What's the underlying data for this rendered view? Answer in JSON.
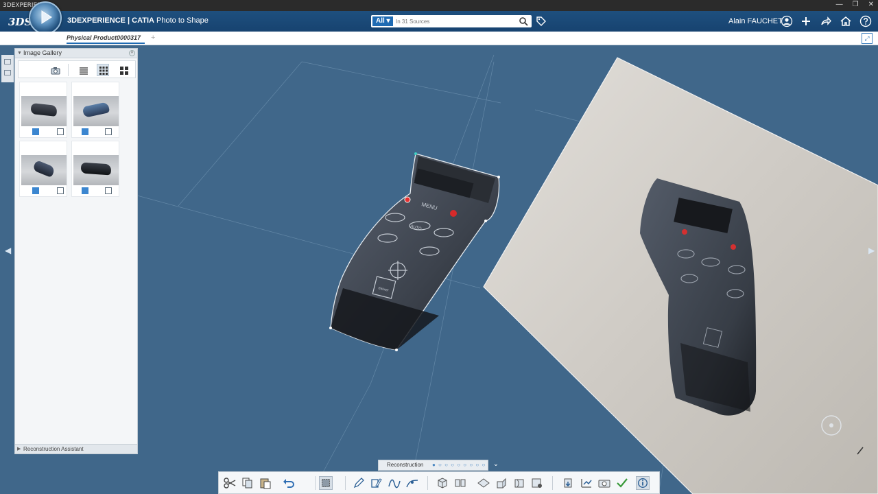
{
  "os": {
    "title": "3DEXPERIENCE"
  },
  "header": {
    "brand": "3DEXPERIENCE | CATIA",
    "app": "Photo to Shape",
    "search": {
      "scope": "All",
      "placeholder": "In 31 Sources"
    },
    "user": "Alain FAUCHET",
    "icons": [
      "user-icon",
      "plus-icon",
      "share-icon",
      "home-icon",
      "help-icon"
    ]
  },
  "tab": {
    "label": "Physical Product0000317",
    "add": "+"
  },
  "gallery": {
    "title": "Image Gallery",
    "footer": "Reconstruction Assistant",
    "thumbnails": [
      {
        "name": "photo-1"
      },
      {
        "name": "photo-2"
      },
      {
        "name": "photo-3"
      },
      {
        "name": "photo-4"
      }
    ]
  },
  "remote": {
    "menu_label": "MENU",
    "auto_label": "AUTO",
    "brand_label": "Steinel"
  },
  "actionbar": {
    "section": "Reconstruction",
    "dots": "● ○ ○ ○ ○ ○ ○ ○ ○"
  },
  "colors": {
    "header": "#1b4777",
    "viewport": "#40678a",
    "accent": "#1f6bb3"
  }
}
